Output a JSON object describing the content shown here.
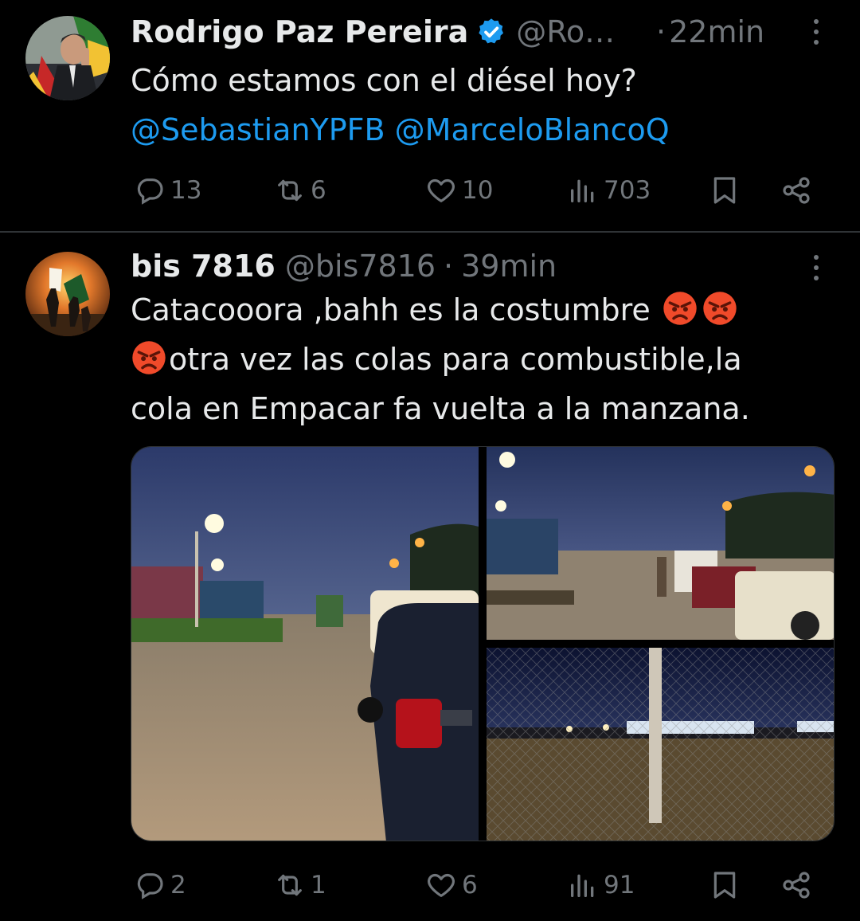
{
  "tweets": [
    {
      "author_name": "Rodrigo Paz Pereira",
      "handle": "@Ro…",
      "separator": "·",
      "time": "22min",
      "verified": true,
      "text": "Cómo estamos con el diésel hoy?",
      "mentions": "@SebastianYPFB @MarceloBlancoQ",
      "stats": {
        "replies": "13",
        "reposts": "6",
        "likes": "10",
        "views": "703"
      }
    },
    {
      "author_name": "bis 7816",
      "handle": "@bis7816",
      "separator": "·",
      "time": "39min",
      "text_line1": "Catacooora ,bahh es la costumbre",
      "text_line2": "otra vez las colas para combustible,la",
      "text_line3": "cola en Empacar fa vuelta a la manzana.",
      "stats": {
        "replies": "2",
        "reposts": "1",
        "likes": "6",
        "views": "91"
      }
    }
  ],
  "icons": {
    "reply": "reply-icon",
    "repost": "repost-icon",
    "like": "heart-icon",
    "views": "views-icon",
    "bookmark": "bookmark-icon",
    "share": "share-icon",
    "more": "more-icon",
    "verified": "verified-badge-icon",
    "emoji": "angry-face-emoji"
  },
  "colors": {
    "background": "#000000",
    "text": "#e7e9ea",
    "muted": "#71767b",
    "link": "#1d9bf0",
    "divider": "#2f3336"
  }
}
